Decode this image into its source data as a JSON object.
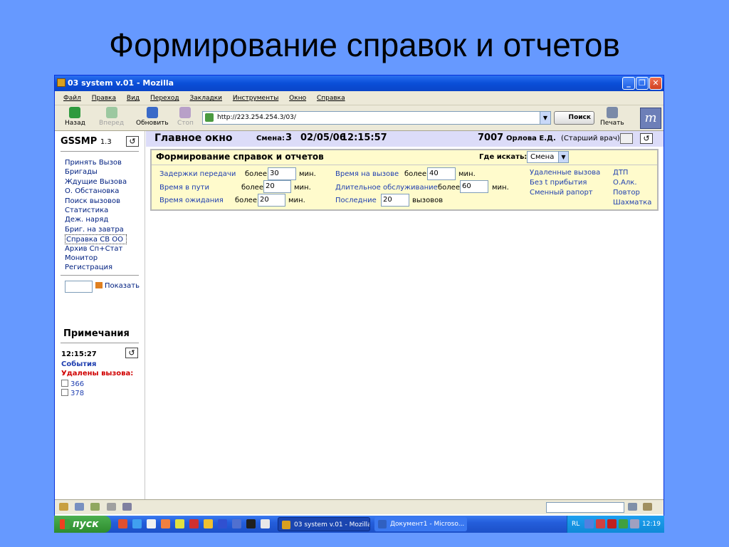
{
  "slide": {
    "title": "Формирование справок и отчетов"
  },
  "window": {
    "title": "03 system v.01 - Mozilla",
    "menu": [
      "Файл",
      "Правка",
      "Вид",
      "Переход",
      "Закладки",
      "Инструменты",
      "Окно",
      "Справка"
    ],
    "toolbar": {
      "back": "Назад",
      "forward": "Вперед",
      "reload": "Обновить",
      "stop": "Стоп",
      "url": "http://223.254.254.3/03/",
      "search": "Поиск",
      "print": "Печать"
    }
  },
  "sidebar": {
    "brand": "GSSMP",
    "version": "1.3",
    "nav": [
      "Принять Вызов",
      "Бригады",
      "Ждущие Вызова",
      "О. Обстановка",
      "Поиск вызовов",
      "Статистика",
      "Деж. наряд",
      "Бриг. на завтра",
      "Справка СВ ОО",
      "Архив Сп+Стат",
      "Монитор",
      "Регистрация"
    ],
    "selected_index": 8,
    "show_label": "Показать",
    "notes_title": "Примечания",
    "notes_time": "12:15:27",
    "events_label": "События",
    "deleted_label": "Удалены вызова:",
    "deleted_items": [
      "366",
      "378"
    ]
  },
  "main": {
    "title": "Главное окно",
    "shift_label": "Смена:",
    "shift_value": "3",
    "date": "02/05/06",
    "time": "12:15:57",
    "code": "7007",
    "user": "Орлова Е.Д.",
    "role": "(Старший врач)"
  },
  "panel": {
    "title": "Формирование справок и отчетов",
    "where_label": "Где искать:",
    "where_value": "Смена",
    "more": "более",
    "min": "мин.",
    "calls": "вызовов",
    "delay_label": "Задержки передачи",
    "delay_value": "30",
    "route_label": "Время в пути",
    "route_value": "20",
    "wait_label": "Время ожидания",
    "wait_value": "20",
    "oncall_label": "Время на вызове",
    "oncall_value": "40",
    "long_label": "Длительное обслуживание",
    "long_value": "60",
    "last_label": "Последние",
    "last_value": "20",
    "links_col1": [
      "Удаленные вызова",
      "Без t прибытия",
      "Сменный рапорт"
    ],
    "links_col2": [
      "ДТП",
      "О.Алк.",
      "Повтор",
      "Шахматка"
    ]
  },
  "taskbar": {
    "start": "пуск",
    "tasks": [
      "03 system v.01 - Mozilla",
      "Документ1 - Microso..."
    ],
    "lang": "RL",
    "clock": "12:19"
  },
  "colors": {
    "background": "#6699ff",
    "titlebar": "#0a4ed8",
    "panel": "#fffbcc",
    "link": "#1f3fb0",
    "alert": "#d00000"
  }
}
